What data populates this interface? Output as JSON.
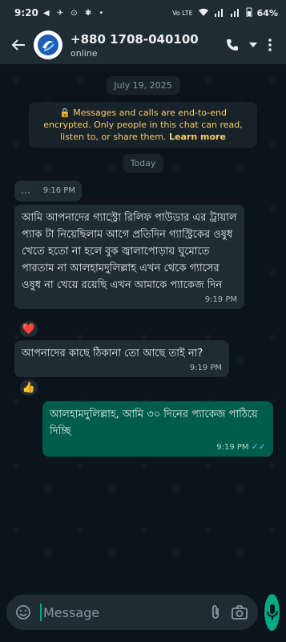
{
  "status_bar": {
    "time": "9:20",
    "notification_icons": "◀ ✈ ⊙ ✱ •",
    "signal_text": "Vo LTE",
    "battery": "64%"
  },
  "header": {
    "contact_name": "+880 1708-040100",
    "status": "online"
  },
  "chat": {
    "date_pill": "July 19, 2025",
    "encryption_notice": "🔒 Messages and calls are end-to-end encrypted. Only people in this chat can read, listen to, or share them.",
    "learn_more": "Learn more",
    "today_pill": "Today",
    "messages": [
      {
        "direction": "in",
        "text": "⋯",
        "time": "9:16 PM"
      },
      {
        "direction": "in",
        "text": "আমি আপনাদের গ্যাস্ট্রো রিলিফ পাউডার এর ট্রায়াল প্যাক টা নিয়েছিলাম  আগে প্রতিদিন গ্যাস্ট্রিকের ওষুধ খেতে হতো না হলে বুক জ্বালাপোড়ায় ঘুমোতে পারতাম না আলহামদুলিল্লাহ এখন থেকে গ্যাসের ওষুধ না খেয়ে রয়েছি এখন আমাকে প্যাকেজ দিন",
        "time": "9:19 PM",
        "reaction": "❤️"
      },
      {
        "direction": "in",
        "text": "আপনাদের কাছে ঠিকানা তো আছে তাই না?",
        "time": "9:19 PM",
        "reaction": "👍"
      },
      {
        "direction": "out",
        "text": "আলহামদুলিল্লাহ, আমি ৩০ দিনের প্যাকেজ পাঠিয়ে দিচ্ছি",
        "time": "9:19 PM",
        "ticks": "✓✓"
      }
    ]
  },
  "composer": {
    "placeholder": "Message"
  },
  "colors": {
    "background": "#0b141a",
    "incoming_bubble": "#1f2c34",
    "outgoing_bubble": "#005c4b",
    "accent": "#00a884",
    "encryption_text": "#f7cd6b",
    "read_ticks": "#53bdeb"
  }
}
